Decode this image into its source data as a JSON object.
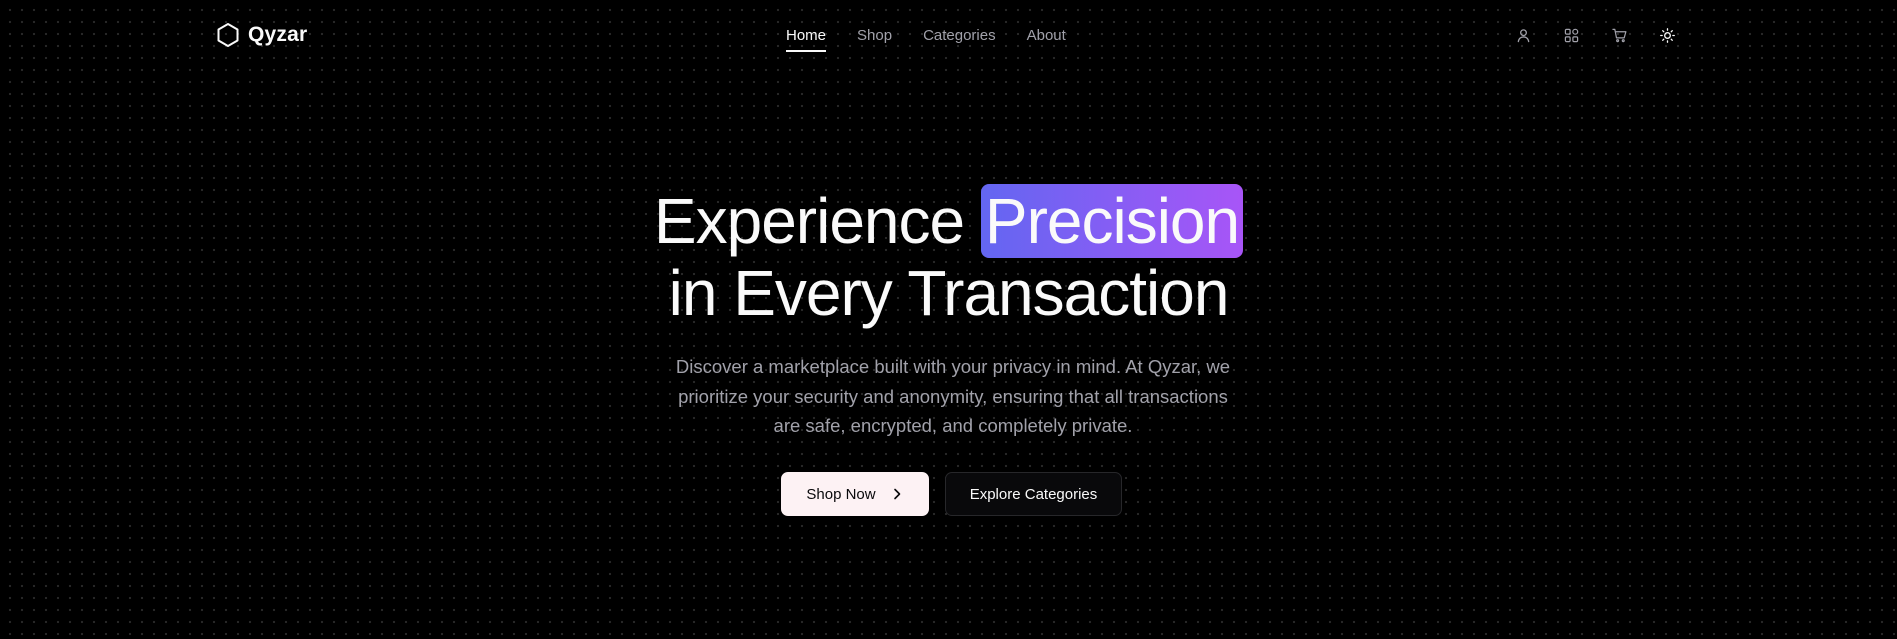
{
  "brand": {
    "name": "Qyzar",
    "icon": "hexagon-icon"
  },
  "nav": {
    "items": [
      {
        "label": "Home",
        "active": true
      },
      {
        "label": "Shop",
        "active": false
      },
      {
        "label": "Categories",
        "active": false
      },
      {
        "label": "About",
        "active": false
      }
    ]
  },
  "header_icons": [
    "user-icon",
    "grid-icon",
    "cart-icon",
    "sun-icon"
  ],
  "hero": {
    "title_part1": "Experience ",
    "title_highlight": "Precision",
    "title_part2": "in Every Transaction",
    "description": "Discover a marketplace built with your privacy in mind. At Qyzar, we prioritize your security and anonymity, ensuring that all transactions are safe, encrypted, and completely private.",
    "primary_button": "Shop Now",
    "secondary_button": "Explore Categories"
  },
  "colors": {
    "background": "#000000",
    "text": "#fafafa",
    "muted": "#a1a1aa",
    "highlight_from": "#6366f1",
    "highlight_to": "#a855f7",
    "primary_button_bg": "#fdf2f4"
  }
}
